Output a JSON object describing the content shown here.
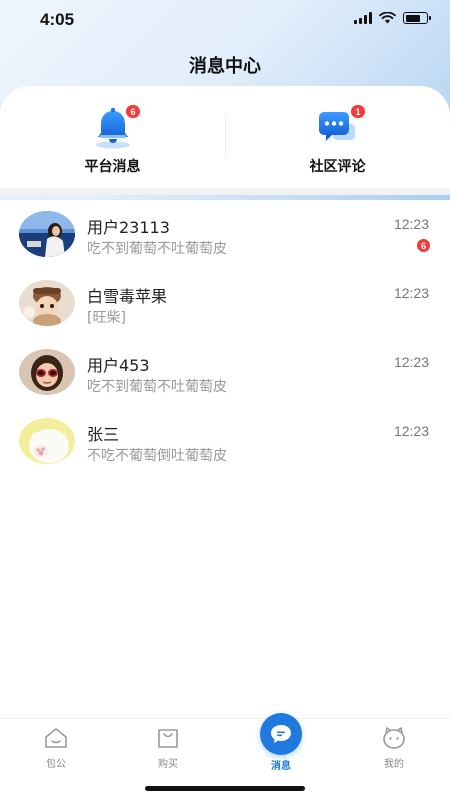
{
  "status_bar": {
    "time": "4:05"
  },
  "page": {
    "title": "消息中心"
  },
  "categories": [
    {
      "label": "平台消息",
      "icon": "bell-icon",
      "badge": "6"
    },
    {
      "label": "社区评论",
      "icon": "chat-bubble-icon",
      "badge": "1"
    }
  ],
  "messages": [
    {
      "name": "用户23113",
      "preview": "吃不到葡萄不吐葡萄皮",
      "time": "12:23",
      "badge": "6"
    },
    {
      "name": "白雪毒苹果",
      "preview": "[旺柴]",
      "time": "12:23"
    },
    {
      "name": "用户453",
      "preview": "吃不到葡萄不吐葡萄皮",
      "time": "12:23"
    },
    {
      "name": "张三",
      "preview": "不吃不葡萄倒吐葡萄皮",
      "time": "12:23"
    }
  ],
  "tabs": [
    {
      "label": "包公",
      "icon": "home-icon"
    },
    {
      "label": "购买",
      "icon": "shopping-bag-icon"
    },
    {
      "label": "消息",
      "icon": "message-icon",
      "active": true
    },
    {
      "label": "我的",
      "icon": "profile-face-icon"
    }
  ],
  "colors": {
    "accent": "#1f7ae0",
    "badge": "#f23b3b",
    "preview_text": "#9a9a9a"
  }
}
